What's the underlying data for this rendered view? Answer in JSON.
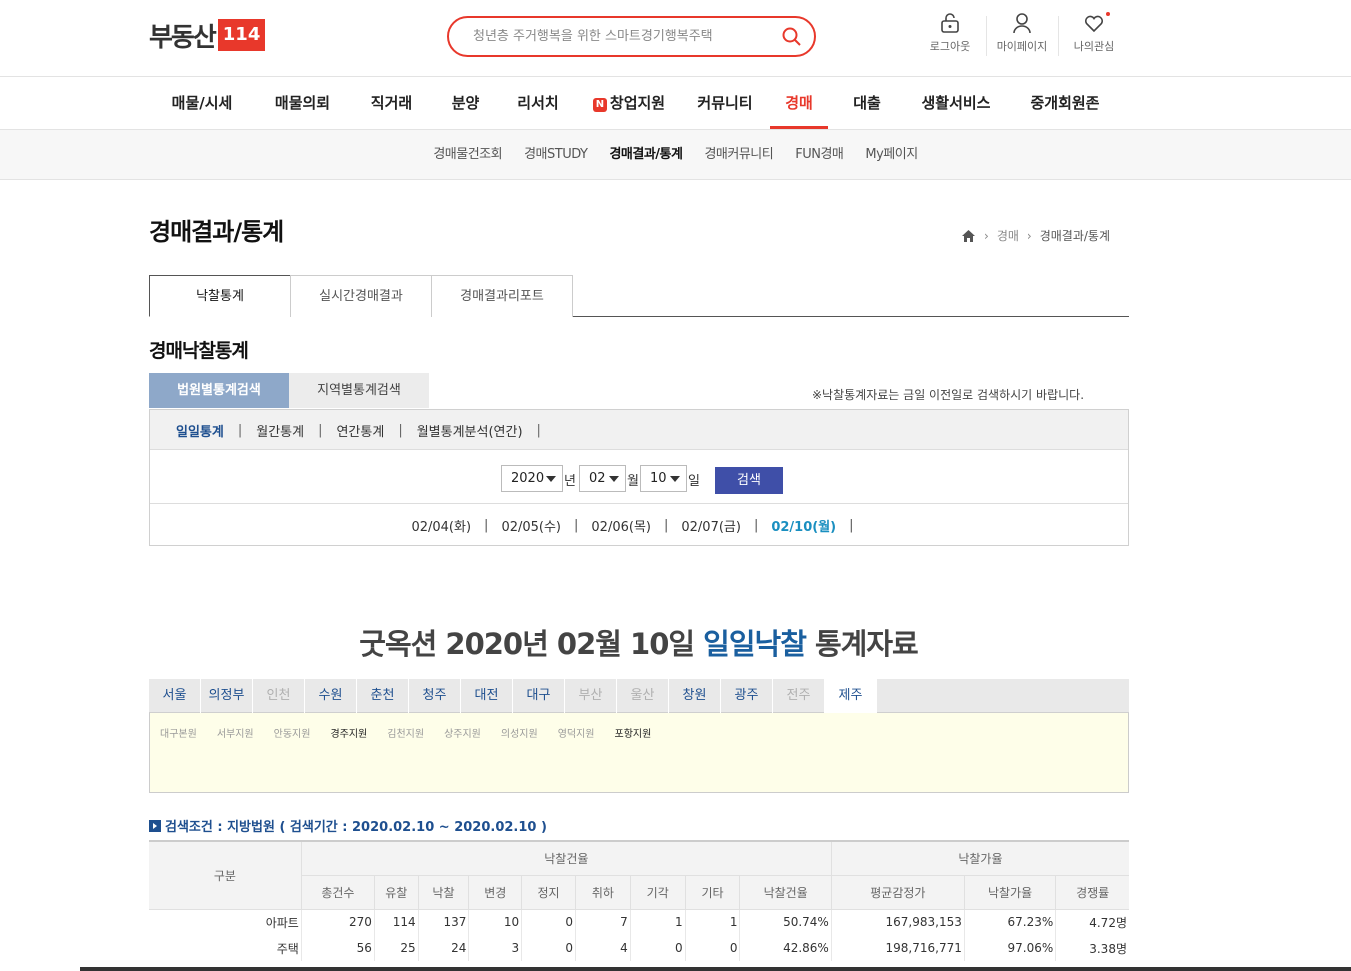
{
  "header": {
    "logo_text": "부동산",
    "logo_badge": "114",
    "search_placeholder": "청년층 주거행복을 위한 스마트경기행복주택",
    "utils": [
      {
        "label": "로그아웃",
        "icon": "logout-icon"
      },
      {
        "label": "마이페이지",
        "icon": "user-icon"
      },
      {
        "label": "나의관심",
        "icon": "heart-icon"
      }
    ]
  },
  "gnb": {
    "items": [
      "매물/시세",
      "매물의뢰",
      "직거래",
      "분양",
      "리서치",
      "창업지원",
      "커뮤니티",
      "경매",
      "대출",
      "생활서비스",
      "중개회원존"
    ],
    "badge": "N",
    "active_index": 7
  },
  "subnav": {
    "items": [
      "경매물건조회",
      "경매STUDY",
      "경매결과/통계",
      "경매커뮤니티",
      "FUN경매",
      "My페이지"
    ],
    "active_index": 2
  },
  "page": {
    "title": "경매결과/통계",
    "breadcrumb": [
      "경매",
      "경매결과/통계"
    ]
  },
  "tabs": [
    "낙찰통계",
    "실시간경매결과",
    "경매결과리포트"
  ],
  "section_title": "경매낙찰통계",
  "search_tabs": [
    "법원별통계검색",
    "지역별통계검색"
  ],
  "notice": "※낙찰통계자료는 금일 이전일로 검색하시기 바랍니다.",
  "period_tabs": [
    "일일통계",
    "월간통계",
    "연간통계",
    "월별통계분석(연간)"
  ],
  "date_select": {
    "year": "2020",
    "year_unit": "년",
    "month": "02",
    "month_unit": "월",
    "day": "10",
    "day_unit": "일",
    "button": "검색"
  },
  "dates": [
    "02/04(화)",
    "02/05(수)",
    "02/06(목)",
    "02/07(금)",
    "02/10(월)"
  ],
  "big_title": {
    "prefix": "굿옥션 2020년 02월 10일 ",
    "highlight": "일일낙찰",
    "suffix": " 통계자료"
  },
  "regions": [
    "서울",
    "의정부",
    "인천",
    "수원",
    "춘천",
    "청주",
    "대전",
    "대구",
    "부산",
    "울산",
    "창원",
    "광주",
    "전주",
    "제주"
  ],
  "regions_dim": [
    2,
    8,
    9,
    12
  ],
  "courts": [
    "대구본원",
    "서부지원",
    "안동지원",
    "경주지원",
    "김천지원",
    "상주지원",
    "의성지원",
    "영덕지원",
    "포항지원"
  ],
  "courts_on": [
    3,
    8
  ],
  "condition": "검색조건 : 지방법원 ( 검색기간 : 2020.02.10 ~ 2020.02.10 )",
  "table": {
    "col_group": "구분",
    "group1": "낙찰건율",
    "group2": "낙찰가율",
    "headers": [
      "총건수",
      "유찰",
      "낙찰",
      "변경",
      "정지",
      "취하",
      "기각",
      "기타",
      "낙찰건율",
      "평균감정가",
      "낙찰가율",
      "경쟁률"
    ],
    "rows": [
      {
        "label": "아파트",
        "cells": [
          "270",
          "114",
          "137",
          "10",
          "0",
          "7",
          "1",
          "1",
          "50.74%",
          "167,983,153",
          "67.23%",
          "4.72명"
        ]
      },
      {
        "label": "주택",
        "cells": [
          "56",
          "25",
          "24",
          "3",
          "0",
          "4",
          "0",
          "0",
          "42.86%",
          "198,716,771",
          "97.06%",
          "3.38명"
        ]
      }
    ]
  }
}
